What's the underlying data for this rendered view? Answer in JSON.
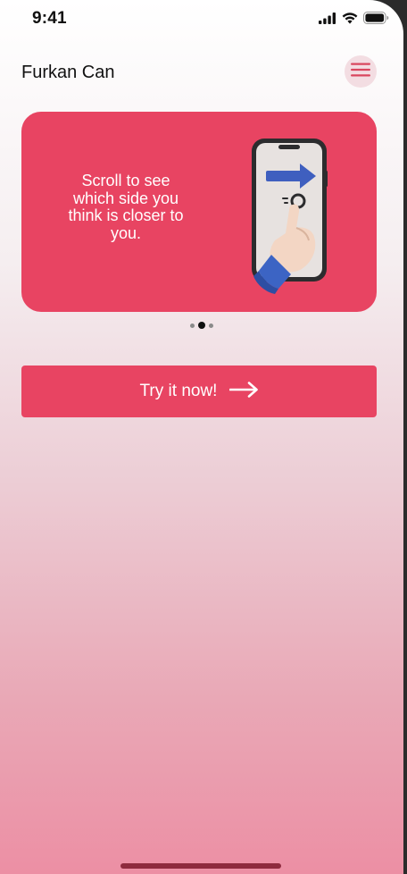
{
  "status_bar": {
    "time": "9:41"
  },
  "header": {
    "user_name": "Furkan Can"
  },
  "banner": {
    "text": "Scroll to see which side you think is closer to you.",
    "illustration_icon": "hand-swipe-phone-icon"
  },
  "pager": {
    "total": 3,
    "active_index": 1
  },
  "cta": {
    "label": "Try it now!",
    "icon": "arrow-right-icon"
  },
  "colors": {
    "accent": "#e84462",
    "menu_bg": "#f3dde2",
    "text_primary": "#111111",
    "white": "#ffffff"
  }
}
